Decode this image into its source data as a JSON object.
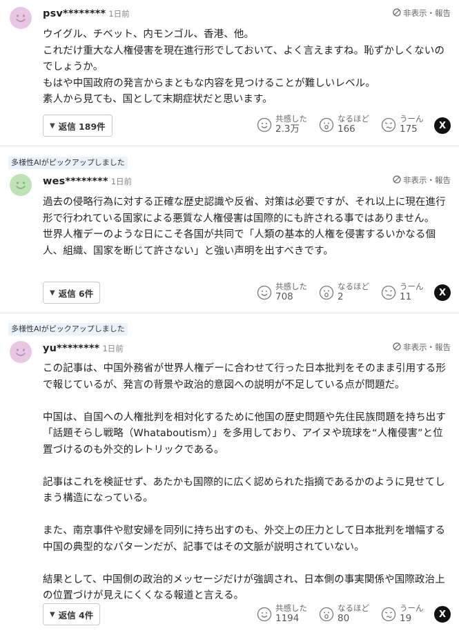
{
  "colors": {
    "avatar_pink": "#e7c7e4",
    "avatar_green": "#bfe2b7",
    "ai_badge_bg": "#eaf3fb",
    "divider": "#e3e3e3"
  },
  "reaction_labels": {
    "empathy": "共感した",
    "agree": "なるほど",
    "hmm": "うーん"
  },
  "report_label": "非表示・報告",
  "share_x_label": "X",
  "comments": [
    {
      "username": "psv********",
      "time": "1日前",
      "ai_pick": "",
      "text": "ウイグル、チベット、内モンゴル、香港、他。\nこれだけ重大な人権侵害を現在進行形でしておいて、よく言えますね。恥ずかしくないのでしょうか。\nもはや中国政府の発言からまともな内容を見つけることが難しいレベル。\n素人から見ても、国として末期症状だと思います。",
      "reply_label": "返信 189件",
      "empathy": "2.3万",
      "agree": "166",
      "hmm": "175"
    },
    {
      "username": "wes********",
      "time": "1日前",
      "ai_pick": "多様性AIがピックアップしました",
      "text": "過去の侵略行為に対する正確な歴史認識や反省、対策は必要ですが、それ以上に現在進行形で行われている国家による悪質な人権侵害は国際的にも許される事ではありません。\n世界人権デーのような日にこそ各国が共同で「人類の基本的人権を侵害するいかなる個人、組織、国家を断じて許さない」と強い声明を出すべきです。",
      "reply_label": "返信 6件",
      "empathy": "708",
      "agree": "2",
      "hmm": "11"
    },
    {
      "username": "yu********",
      "time": "1日前",
      "ai_pick": "多様性AIがピックアップしました",
      "text": "この記事は、中国外務省が世界人権デーに合わせて行った日本批判をそのまま引用する形で報じているが、発言の背景や政治的意図への説明が不足している点が問題だ。\n\n中国は、自国への人権批判を相対化するために他国の歴史問題や先住民族問題を持ち出す「話題そらし戦略（Whataboutism）」を多用しており、アイヌや琉球を“人権侵害”と位置づけるのも外交的レトリックである。\n\n記事はこれを検証せず、あたかも国際的に広く認められた指摘であるかのように見せてしまう構造になっている。\n\nまた、南京事件や慰安婦を同列に持ち出すのも、外交上の圧力として日本批判を増幅する中国の典型的なパターンだが、記事ではその文脈が説明されていない。\n\n結果として、中国側の政治的メッセージだけが強調され、日本側の事実関係や国際政治上の位置づけが見えにくくなる報道と言える。",
      "reply_label": "返信 4件",
      "empathy": "1194",
      "agree": "80",
      "hmm": "19"
    }
  ]
}
